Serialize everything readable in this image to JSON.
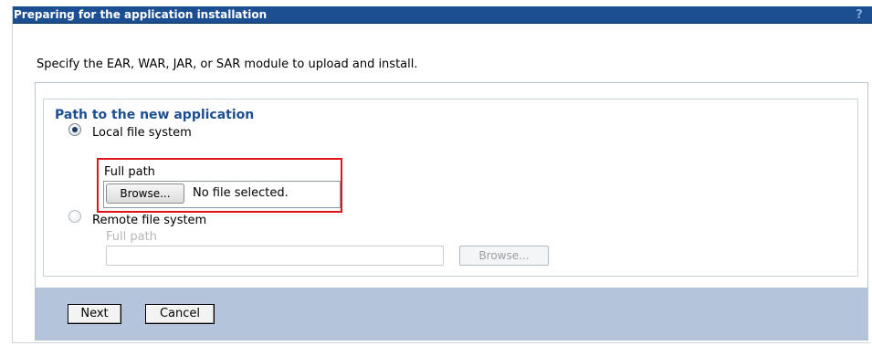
{
  "titlebar": {
    "title": "Preparing for the application installation",
    "help_glyph": "?"
  },
  "instruction": "Specify the EAR, WAR, JAR, or SAR module to upload and install.",
  "path_section": {
    "legend": "Path to the new application",
    "local": {
      "label": "Local file system",
      "checked": true,
      "full_path_label": "Full path",
      "browse_label": "Browse...",
      "file_status": "No file selected."
    },
    "remote": {
      "label": "Remote file system",
      "checked": false,
      "full_path_label": "Full path",
      "value": "",
      "browse_label": "Browse..."
    }
  },
  "buttons": {
    "next": "Next",
    "cancel": "Cancel"
  },
  "colors": {
    "titlebar": "#1c4f92",
    "legend_text": "#1c4f92",
    "button_bar": "#b4c5db",
    "highlight": "#e0141b"
  },
  "icons": [
    "help-icon",
    "radio-button"
  ]
}
